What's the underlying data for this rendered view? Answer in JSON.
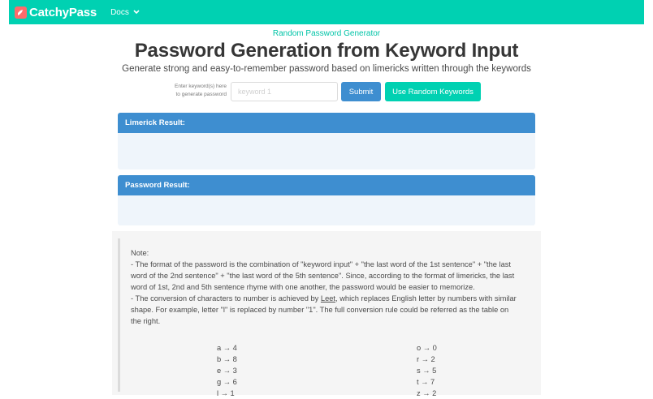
{
  "navbar": {
    "brand": "CatchyPass",
    "docs_label": "Docs",
    "background": "#00d1b2"
  },
  "header": {
    "kicker": "Random Password Generator",
    "title": "Password Generation from Keyword Input",
    "subtitle": "Generate strong and easy-to-remember password based on limericks written through the keywords"
  },
  "form": {
    "label_line1": "Enter keyword(s) here",
    "label_line2": "to generate password",
    "input_placeholder": "keyword 1",
    "input_value": "",
    "submit_label": "Submit",
    "random_label": "Use Random Keywords"
  },
  "limerick": {
    "header": "Limerick Result:",
    "content": ""
  },
  "password": {
    "header": "Password Result:",
    "content": ""
  },
  "note": {
    "heading": "Note:",
    "para1": "- The format of the password is the combination of \"keyword input\" + \"the last word of the 1st sentence\" + \"the last word of the 2nd sentence\" + \"the last word of the 5th sentence\". Since, according to the format of limericks, the last word of 1st, 2nd and 5th sentence rhyme with one another, the password would be easier to memorize.",
    "para2_before": "- The conversion of characters to number is achieved by ",
    "para2_link": "Leet",
    "para2_after": ", which replaces English letter by numbers with similar shape. For example, letter \"l\" is replaced by number \"1\". The full conversion rule could be referred as the table on the right."
  },
  "leet_table": {
    "left": [
      "a → 4",
      "b → 8",
      "e → 3",
      "g → 6",
      "l → 1"
    ],
    "right": [
      "o → 0",
      "r → 2",
      "s → 5",
      "t → 7",
      "z → 2"
    ]
  },
  "colors": {
    "primary": "#00d1b2",
    "info": "#3e8ed0",
    "info_light": "#eff5fb",
    "note_bg": "#f5f5f5"
  }
}
